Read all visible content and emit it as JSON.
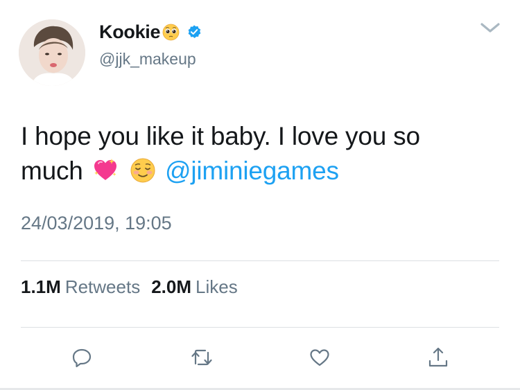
{
  "user": {
    "display_name": "Kookie",
    "handle": "@jjk_makeup",
    "verified": true,
    "name_emoji": "pleading-face-emoji"
  },
  "tweet": {
    "text_line1": "I hope you like it baby. I love you so",
    "text_line2_prefix": "much",
    "emojis": [
      "sparkling-heart-emoji",
      "smiling-face-emoji"
    ],
    "mention": "@jiminiegames",
    "timestamp": "24/03/2019, 19:05"
  },
  "stats": {
    "retweets_count": "1.1M",
    "retweets_label": "Retweets",
    "likes_count": "2.0M",
    "likes_label": "Likes"
  },
  "actions": [
    "reply-icon",
    "retweet-icon",
    "like-icon",
    "share-icon"
  ],
  "colors": {
    "link": "#1da1f2",
    "secondary_text": "#657786",
    "primary_text": "#14171a",
    "divider": "#dcdfe3",
    "icon": "#657786"
  }
}
